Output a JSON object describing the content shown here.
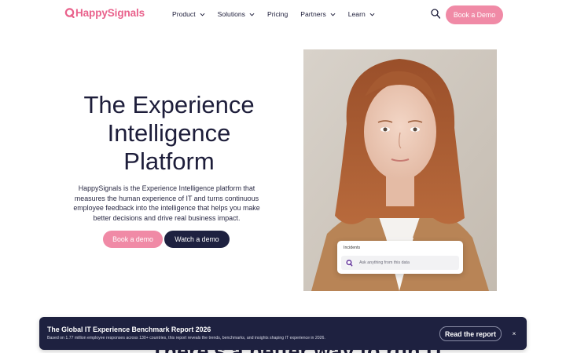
{
  "brand": {
    "name": "HappySignals",
    "color": "#e9628c"
  },
  "nav": {
    "items": [
      {
        "label": "Product",
        "has_dropdown": true
      },
      {
        "label": "Solutions",
        "has_dropdown": true
      },
      {
        "label": "Pricing",
        "has_dropdown": false
      },
      {
        "label": "Partners",
        "has_dropdown": true
      },
      {
        "label": "Learn",
        "has_dropdown": true
      }
    ],
    "search_icon": "search-icon",
    "cta_label": "Book a Demo"
  },
  "hero": {
    "title": "The Experience Intelligence Platform",
    "description": "HappySignals is the Experience Intelligence platform that measures the human experience of IT and turns continuous employee feedback into the intelligence that helps you make better decisions and drive real business impact.",
    "primary_button": "Book a demo",
    "secondary_button": "Watch a demo"
  },
  "incident_card": {
    "title": "Incidents",
    "placeholder": "Ask anything from this data"
  },
  "section": {
    "heading": "There's a better way to run IT"
  },
  "banner": {
    "title": "The Global IT Experience Benchmark Report 2026",
    "subtitle": "Based on 1.77 million employee responses across 130+ countries, this report reveals the trends, benchmarks, and insights shaping IT experience in 2026.",
    "button": "Read the report",
    "close": "×"
  },
  "colors": {
    "accent_pink": "#f08aa6",
    "navy": "#1e2140",
    "text": "#1d1d3a"
  }
}
